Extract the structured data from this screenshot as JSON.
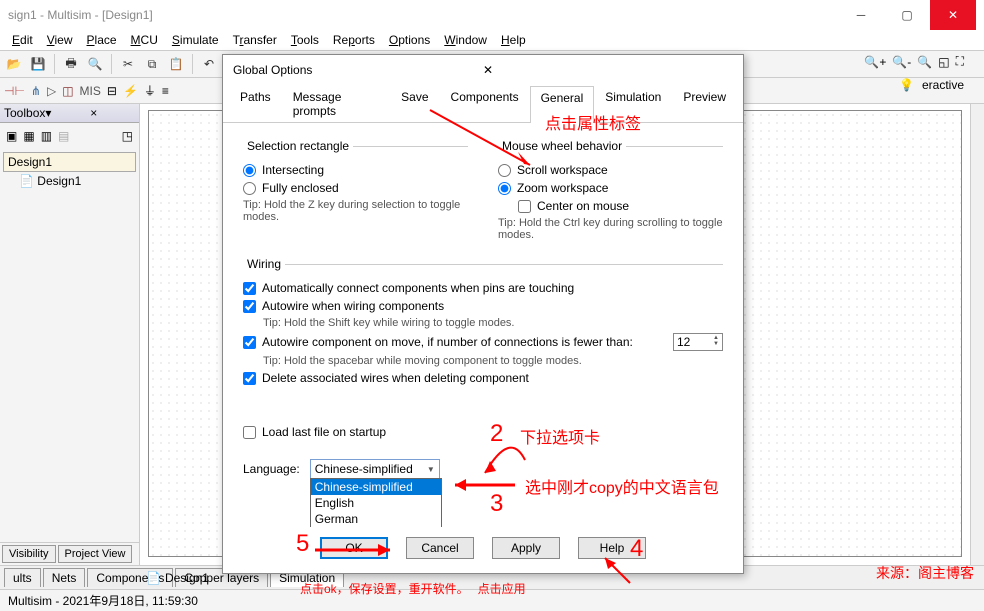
{
  "window": {
    "title": "sign1 - Multisim - [Design1]"
  },
  "menus": [
    "Edit",
    "View",
    "Place",
    "MCU",
    "Simulate",
    "Transfer",
    "Tools",
    "Reports",
    "Options",
    "Window",
    "Help"
  ],
  "toolbox": {
    "title": "Toolbox",
    "designHeader": "Design1",
    "designItem": "Design1",
    "tabs": [
      "Visibility",
      "Project View"
    ]
  },
  "canvas": {
    "tab": "Design1"
  },
  "bottomTabs": [
    "ults",
    "Nets",
    "Components",
    "Copper layers",
    "Simulation"
  ],
  "status": "Multisim  -  2021年9月18日, 11:59:30",
  "toolbarRight": {
    "label": "eractive"
  },
  "dialog": {
    "title": "Global Options",
    "tabs": [
      "Paths",
      "Message prompts",
      "Save",
      "Components",
      "General",
      "Simulation",
      "Preview"
    ],
    "activeTab": "General",
    "selRect": {
      "legend": "Selection rectangle",
      "intersecting": "Intersecting",
      "fully": "Fully enclosed",
      "tip": "Tip: Hold the Z key during selection to toggle modes."
    },
    "mouse": {
      "legend": "Mouse wheel behavior",
      "scroll": "Scroll workspace",
      "zoom": "Zoom workspace",
      "center": "Center on mouse",
      "tip": "Tip: Hold the Ctrl key during scrolling to toggle modes."
    },
    "wiring": {
      "legend": "Wiring",
      "auto1": "Automatically connect components when pins are touching",
      "auto2": "Autowire when wiring components",
      "tip2": "Tip: Hold the Shift key while wiring to toggle modes.",
      "auto3": "Autowire component on move, if number of connections is fewer than:",
      "num": "12",
      "tip3": "Tip: Hold the spacebar while moving component to toggle modes.",
      "del": "Delete associated wires when deleting component"
    },
    "loadLast": "Load last file on startup",
    "langLabel": "Language:",
    "langValue": "Chinese-simplified",
    "langOptions": [
      "Chinese-simplified",
      "English",
      "German"
    ],
    "buttons": {
      "ok": "OK",
      "cancel": "Cancel",
      "apply": "Apply",
      "help": "Help"
    }
  },
  "annotations": {
    "a1": "点击属性标签",
    "a2": "下拉选项卡",
    "a3": "选中刚才copy的中文语言包",
    "a4": "点击ok，保存设置，重开软件。",
    "a4b": "点击应用",
    "n2": "2",
    "n3": "3",
    "n4": "4",
    "n5": "5"
  },
  "watermark": "来源：阁主博客"
}
